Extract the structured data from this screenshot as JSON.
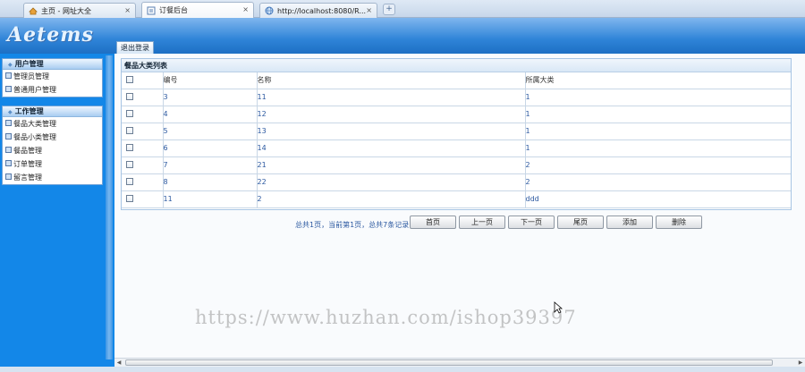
{
  "browser": {
    "tabs": [
      {
        "label": "主页 - 网址大全",
        "close": "×"
      },
      {
        "label": "订餐后台",
        "close": "×"
      },
      {
        "label": "http://localhost:8080/R...",
        "close": "×"
      }
    ],
    "new_tab": "+"
  },
  "header": {
    "logo": "Aetems",
    "logout_tab": "退出登录"
  },
  "sidebar": {
    "groups": [
      {
        "title": "用户管理",
        "items": [
          "管理员管理",
          "普通用户管理"
        ]
      },
      {
        "title": "工作管理",
        "items": [
          "餐品大类管理",
          "餐品小类管理",
          "餐品管理",
          "订单管理",
          "留言管理"
        ]
      }
    ]
  },
  "panel": {
    "title": "餐品大类列表",
    "columns": [
      "编号",
      "名称",
      "所属大类"
    ],
    "rows": [
      [
        "3",
        "11",
        "1"
      ],
      [
        "4",
        "12",
        "1"
      ],
      [
        "5",
        "13",
        "1"
      ],
      [
        "6",
        "14",
        "1"
      ],
      [
        "7",
        "21",
        "2"
      ],
      [
        "8",
        "22",
        "2"
      ],
      [
        "11",
        "2",
        "ddd"
      ]
    ]
  },
  "pager": {
    "summary": "总共1页，当前第1页，总共7条记录",
    "buttons": [
      "首页",
      "上一页",
      "下一页",
      "尾页",
      "添加",
      "删除"
    ]
  },
  "watermark": "https://www.huzhan.com/ishop39397",
  "colors": {
    "sidebar": "#1387e8",
    "header": "#2f84d8",
    "link": "#2b58a0"
  }
}
